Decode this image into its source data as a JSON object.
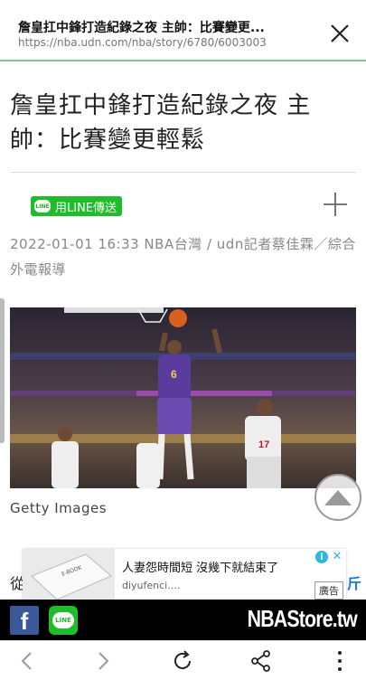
{
  "topbar": {
    "title": "詹皇扛中鋒打造紀錄之夜 主帥：比賽變更...",
    "url": "https://nba.udn.com/nba/story/6780/6003003"
  },
  "article": {
    "headline": "詹皇扛中鋒打造紀錄之夜 主帥：比賽變更輕鬆",
    "share_label": "用LINE傳送",
    "line_badge": "LINE",
    "meta": "2022-01-01 16:33  NBA台灣 / udn記者蔡佳霖／綜合外電報導",
    "photo_caption": "Getty Images"
  },
  "behind": {
    "left_char": "從",
    "right_char": "斤"
  },
  "ad": {
    "title": "人妻怨時間短 沒幾下就結束了",
    "domain": "diyufenci....",
    "label": "廣告",
    "info": "i",
    "close": "✕"
  },
  "footer": {
    "facebook": "f",
    "line": "LINE",
    "store": "NBAStore.tw"
  },
  "colors": {
    "accent_line": "#1fbd2a",
    "facebook": "#3b5998",
    "topbar_border": "#7cc98a"
  },
  "icons": [
    "close-icon",
    "plus-icon",
    "scroll-top-icon",
    "back-icon",
    "forward-icon",
    "reload-icon",
    "share-icon",
    "more-icon"
  ]
}
